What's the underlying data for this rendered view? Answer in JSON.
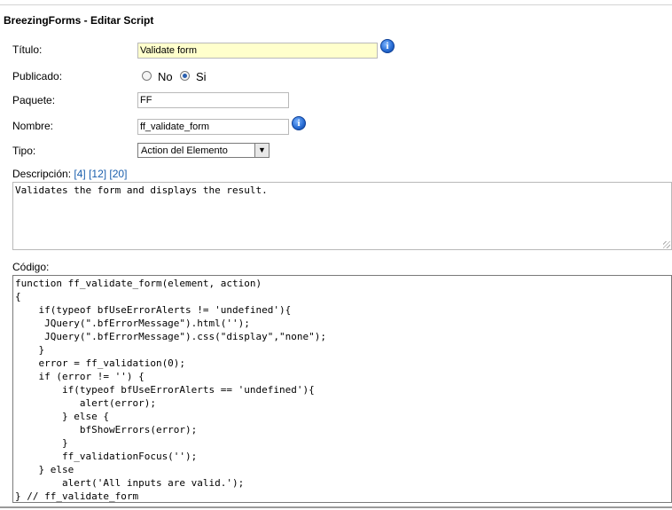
{
  "page": {
    "header": "BreezingForms - Editar Script"
  },
  "form": {
    "titulo": {
      "label": "Título:",
      "value": "Validate form"
    },
    "publicado": {
      "label": "Publicado:",
      "options": [
        "No",
        "Si"
      ],
      "selected": "Si"
    },
    "paquete": {
      "label": "Paquete:",
      "value": "FF"
    },
    "nombre": {
      "label": "Nombre:",
      "value": "ff_validate_form"
    },
    "tipo": {
      "label": "Tipo:",
      "value": "Action del Elemento"
    },
    "descripcion": {
      "label": "Descripción:",
      "size_links": [
        "[4]",
        "[12]",
        "[20]"
      ],
      "value": "Validates the form and displays the result."
    },
    "codigo": {
      "label": "Código:",
      "value": "function ff_validate_form(element, action)\n{\n    if(typeof bfUseErrorAlerts != 'undefined'){\n     JQuery(\".bfErrorMessage\").html('');\n     JQuery(\".bfErrorMessage\").css(\"display\",\"none\");\n    }\n    error = ff_validation(0);\n    if (error != '') {\n        if(typeof bfUseErrorAlerts == 'undefined'){\n           alert(error);\n        } else {\n           bfShowErrors(error);\n        }\n        ff_validationFocus('');\n    } else\n        alert('All inputs are valid.');\n} // ff_validate_form"
    }
  },
  "icons": {
    "info": "info-icon",
    "info_glyph": "i",
    "dropdown_glyph": "▼"
  }
}
